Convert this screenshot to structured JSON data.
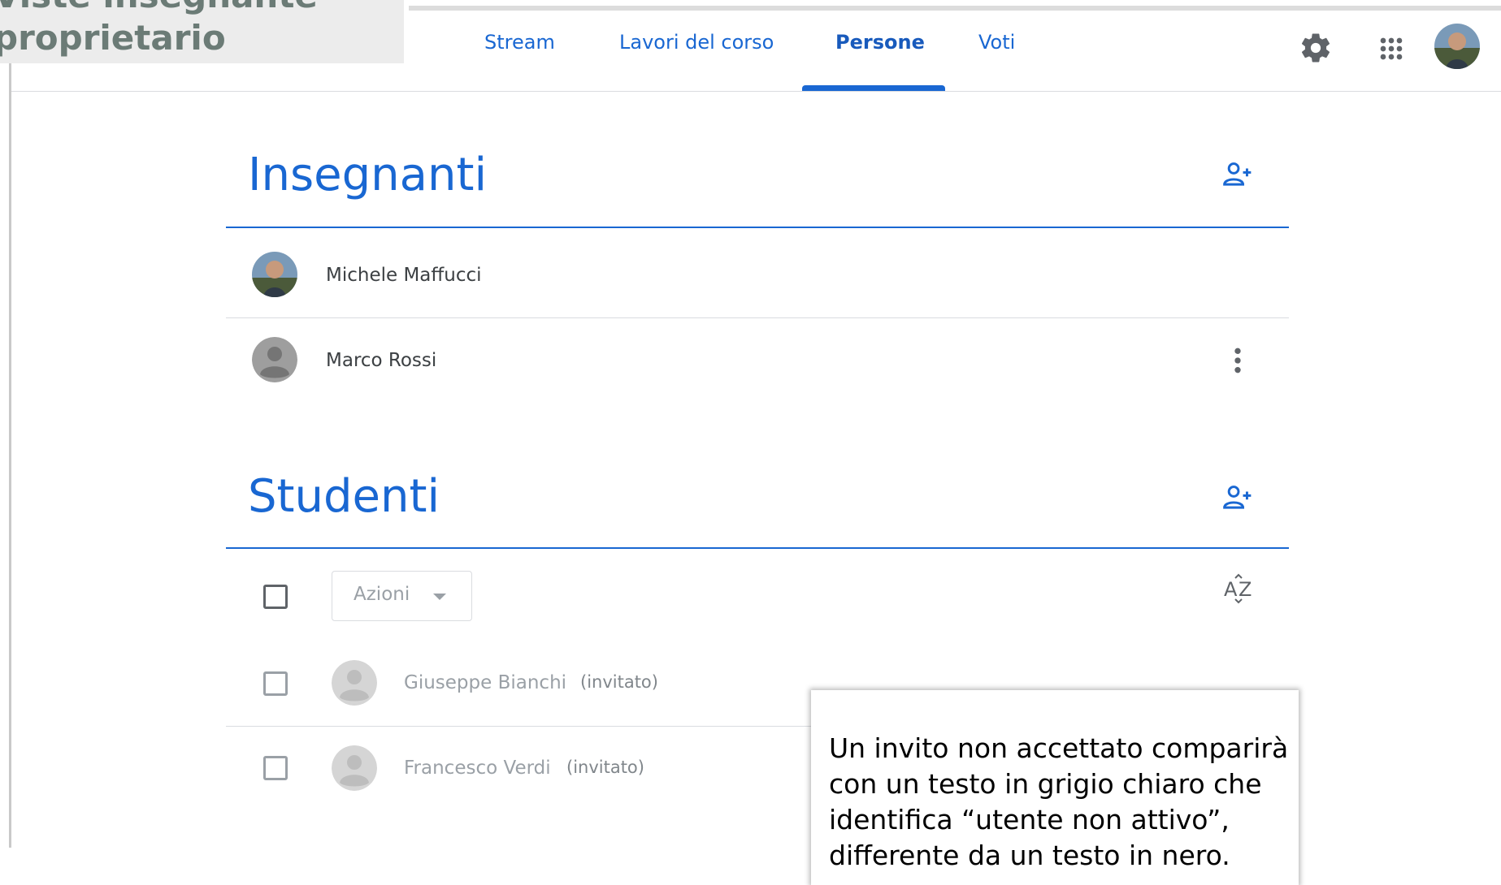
{
  "annotation": {
    "line1": "Viste insegnante",
    "line2": "proprietario"
  },
  "tabs": [
    {
      "label": "Stream",
      "active": false
    },
    {
      "label": "Lavori del corso",
      "active": false
    },
    {
      "label": "Persone",
      "active": true
    },
    {
      "label": "Voti",
      "active": false
    }
  ],
  "header_icons": [
    "gear-icon",
    "apps-grid-icon",
    "account-avatar"
  ],
  "teachers": {
    "title": "Insegnanti",
    "people": [
      {
        "name": "Michele Maffucci",
        "avatar": "photo"
      },
      {
        "name": "Marco Rossi",
        "avatar": "placeholder"
      }
    ]
  },
  "students": {
    "title": "Studenti",
    "actions_label": "Azioni",
    "sort_icon": "A-Z",
    "people": [
      {
        "name": "Giuseppe Bianchi",
        "status": "(invitato)"
      },
      {
        "name": "Francesco Verdi",
        "status": "(invitato)"
      }
    ]
  },
  "callout": {
    "text": "Un invito non accettato comparirà con un testo in grigio chiaro che identifica “utente non attivo”, differente da un testo in nero."
  },
  "colors": {
    "accent": "#1967d2",
    "text": "#3c4043",
    "muted": "#9aa0a6"
  }
}
